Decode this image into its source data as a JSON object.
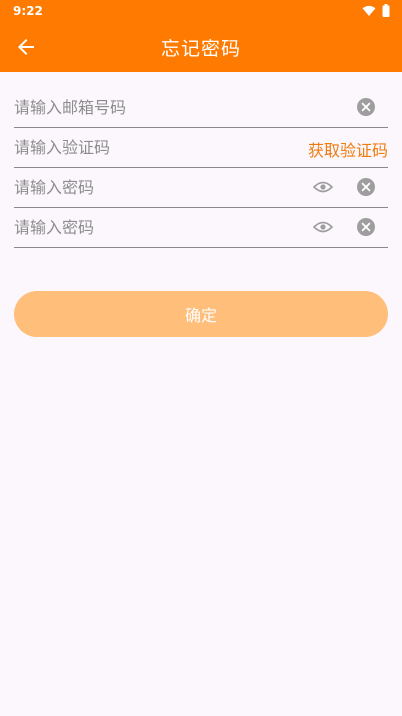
{
  "status_bar": {
    "time": "9:22"
  },
  "header": {
    "title": "忘记密码"
  },
  "form": {
    "email": {
      "placeholder": "请输入邮箱号码",
      "value": ""
    },
    "code": {
      "placeholder": "请输入验证码",
      "value": "",
      "get_code_label": "获取验证码"
    },
    "password": {
      "placeholder": "请输入密码",
      "value": ""
    },
    "confirm_password": {
      "placeholder": "请输入密码",
      "value": ""
    }
  },
  "confirm_button": {
    "label": "确定"
  },
  "colors": {
    "primary": "#ff7a00",
    "button": "#ffbe7a",
    "link": "#ef7b0e",
    "background": "#fcf7fd"
  }
}
